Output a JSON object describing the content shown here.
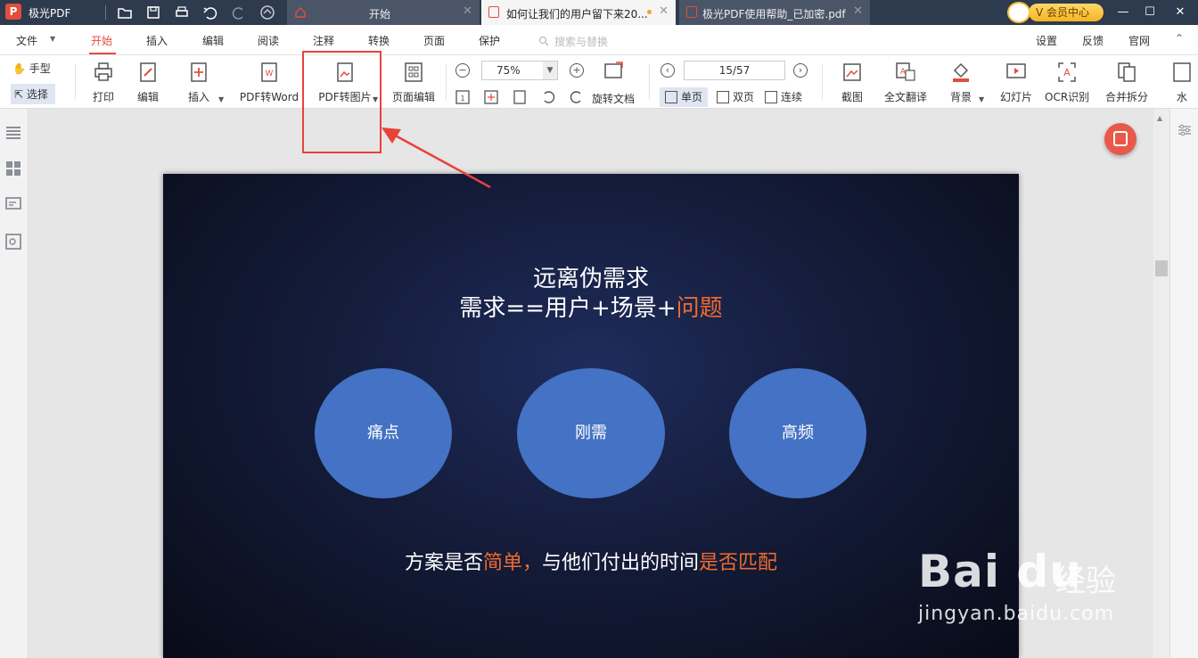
{
  "app": {
    "logo_letter": "P",
    "name": "极光PDF"
  },
  "tabs": [
    {
      "label": "开始"
    },
    {
      "label": "如何让我们的用户留下来20..."
    },
    {
      "label": "极光PDF使用帮助_已加密.pdf"
    }
  ],
  "member": {
    "label": "V 会员中心"
  },
  "window_controls": {
    "minimize": "—",
    "maximize": "☐",
    "close": "✕"
  },
  "menu": {
    "items": [
      "文件",
      "开始",
      "插入",
      "编辑",
      "阅读",
      "注释",
      "转换",
      "页面",
      "保护"
    ],
    "active": "开始",
    "search_placeholder": "搜索与替换",
    "right_items": [
      "设置",
      "反馈",
      "官网"
    ]
  },
  "toolbar": {
    "hand_label": "手型",
    "select_label": "选择",
    "print_label": "打印",
    "edit_label": "编辑",
    "insert_label": "插入",
    "pdf_to_word_label": "PDF转Word",
    "pdf_to_image_label": "PDF转图片",
    "page_edit_label": "页面编辑",
    "zoom_value": "75%",
    "rotate_doc_label": "旋转文档",
    "page_indicator": "15/57",
    "single_page_label": "单页",
    "double_page_label": "双页",
    "continuous_label": "连续",
    "screenshot_label": "截图",
    "translate_label": "全文翻译",
    "background_label": "背景",
    "slideshow_label": "幻灯片",
    "ocr_label": "OCR识别",
    "merge_split_label": "合并拆分",
    "watermark_label": "水"
  },
  "slide": {
    "title": "远离伪需求",
    "subtitle_white": "需求==用户+场景+",
    "subtitle_orange": "问题",
    "bubbles": [
      "痛点",
      "刚需",
      "高频"
    ],
    "bottom_1": "方案是否",
    "bottom_2": "简单，",
    "bottom_3": "与他们付出的时间",
    "bottom_4": "是否匹配"
  },
  "watermark": {
    "logo": "Bai du",
    "cn": "经验",
    "url": "jingyan.baidu.com"
  },
  "colors": {
    "accent": "#e34d3b",
    "highlight": "#e8423a",
    "bubble": "#4472c4",
    "orange_text": "#f06b2d"
  }
}
